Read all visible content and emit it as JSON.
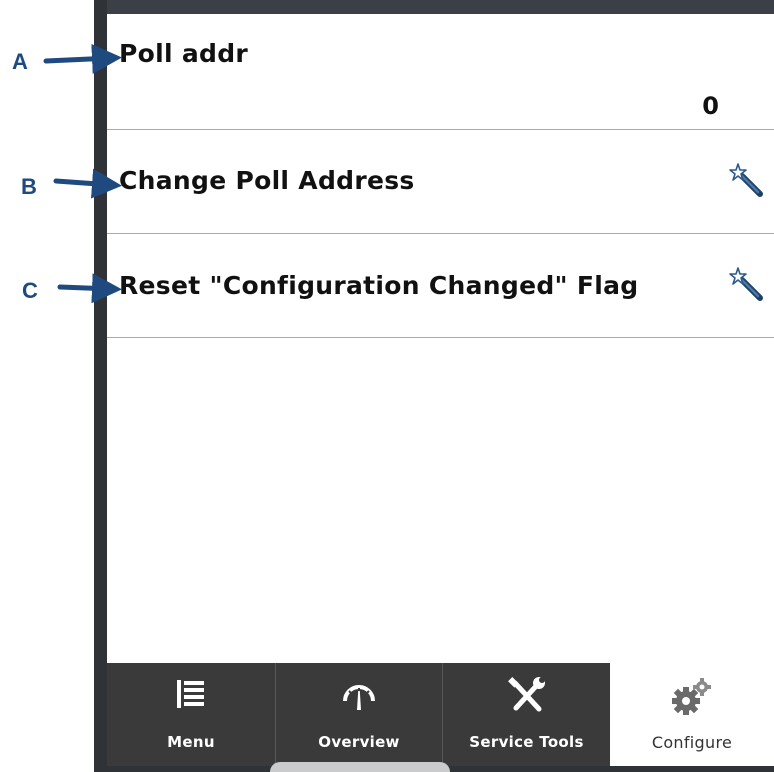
{
  "rows": [
    {
      "label": "Poll addr",
      "value": "0"
    },
    {
      "label": "Change Poll Address",
      "icon": "wizard-wand-icon"
    },
    {
      "label": "Reset \"Configuration Changed\" Flag",
      "icon": "wizard-wand-icon"
    }
  ],
  "callouts": [
    "A",
    "B",
    "C"
  ],
  "tabs": [
    {
      "label": "Menu",
      "icon": "menu-list-icon"
    },
    {
      "label": "Overview",
      "icon": "gauge-icon"
    },
    {
      "label": "Service Tools",
      "icon": "tools-icon"
    },
    {
      "label": "Configure",
      "icon": "gears-icon",
      "selected": true
    }
  ],
  "colors": {
    "callout": "#1f4a80",
    "tabbar": "#3a3a3a",
    "frame": "#2f3337",
    "divider": "#a9a9a9"
  }
}
